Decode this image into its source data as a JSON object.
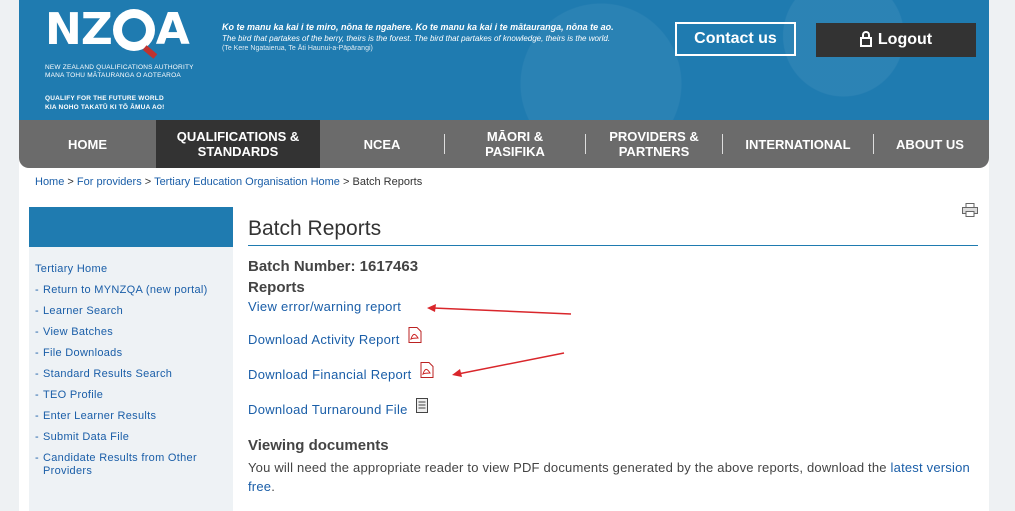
{
  "header": {
    "logo_text": "NZQA",
    "logo_subtitle_1": "NEW ZEALAND QUALIFICATIONS AUTHORITY",
    "logo_subtitle_2": "MANA TOHU MĀTAURANGA O AOTEAROA",
    "tagline_1": "QUALIFY FOR THE FUTURE WORLD",
    "tagline_2": "KIA NOHO TAKATŪ KI TŌ ĀMUA AO!",
    "proverb_line1": "Ko te manu ka kai i te miro, nōna te ngahere. Ko te manu ka kai i te mātauranga, nōna te ao.",
    "proverb_line2": "The bird that partakes of the berry, theirs is the forest. The bird that partakes of knowledge, theirs is the world.",
    "proverb_line3": "(Te Kere Ngataierua, Te Āti Haunui-a-Pāpārangi)",
    "contact_label": "Contact us",
    "logout_label": "Logout"
  },
  "nav": {
    "items": [
      {
        "label": "HOME"
      },
      {
        "label": "QUALIFICATIONS & STANDARDS"
      },
      {
        "label": "NCEA"
      },
      {
        "label": "MĀORI & PASIFIKA"
      },
      {
        "label": "PROVIDERS & PARTNERS"
      },
      {
        "label": "INTERNATIONAL"
      },
      {
        "label": "ABOUT US"
      }
    ]
  },
  "breadcrumb": {
    "items": [
      "Home",
      "For providers",
      "Tertiary Education Organisation Home"
    ],
    "separator": ">",
    "current": "Batch Reports"
  },
  "sidebar": {
    "items": [
      {
        "label": "Tertiary Home"
      },
      {
        "label": "Return to MYNZQA (new portal)"
      },
      {
        "label": "Learner Search"
      },
      {
        "label": "View Batches"
      },
      {
        "label": "File Downloads"
      },
      {
        "label": "Standard Results Search"
      },
      {
        "label": "TEO Profile"
      },
      {
        "label": "Enter Learner Results"
      },
      {
        "label": "Submit Data File"
      },
      {
        "label": "Candidate Results from Other Providers"
      }
    ]
  },
  "main": {
    "title": "Batch Reports",
    "batch_label": "Batch Number: 1617463",
    "reports_heading": "Reports",
    "links": [
      {
        "label": "View error/warning report",
        "icon": "none"
      },
      {
        "label": "Download Activity Report",
        "icon": "pdf-icon"
      },
      {
        "label": "Download Financial Report",
        "icon": "pdf-icon"
      },
      {
        "label": "Download Turnaround File",
        "icon": "file-icon"
      }
    ],
    "viewing_heading": "Viewing documents",
    "viewing_text": "You will need the appropriate reader to view PDF documents generated by the above reports, download the",
    "viewing_link": "latest version free",
    "viewing_end": "."
  },
  "colors": {
    "brand_blue": "#1f7bb0",
    "nav_grey": "#6b6b6b",
    "nav_active": "#333333",
    "link": "#1a5ea8",
    "annotation_arrow": "#d9262b"
  }
}
